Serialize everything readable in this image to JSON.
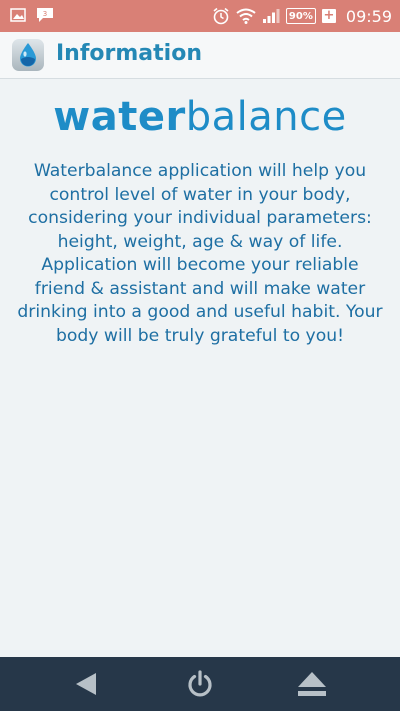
{
  "status_bar": {
    "battery_percent": "90%",
    "battery_plus": "+",
    "time": "09:59",
    "icons": [
      "image-notification-icon",
      "message-notification-icon",
      "alarm-clock-icon",
      "wifi-icon",
      "signal-icon"
    ]
  },
  "action_bar": {
    "icon": "water-drop-app-icon",
    "title": "Information"
  },
  "content": {
    "logo_bold": "water",
    "logo_light": "balance",
    "description": "Waterbalance application will help you control level of water in your body, considering your individual parameters: height, weight, age & way of life. Application will become your reliable friend & assistant and will make water drinking into a good and useful habit. Your body will be truly grateful to you!"
  },
  "nav_bar": {
    "icons": [
      "back-icon",
      "power-icon",
      "eject-icon"
    ]
  },
  "colors": {
    "status_bar": "#d98076",
    "accent": "#2488b5",
    "logo": "#1e8cc7",
    "nav_bar": "#263749",
    "background": "#eff3f5"
  }
}
